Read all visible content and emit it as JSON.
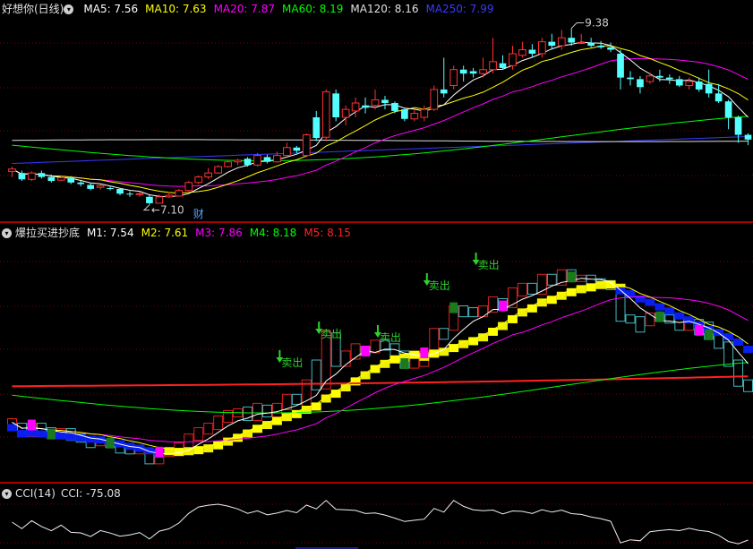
{
  "main": {
    "title": "好想你(日线)",
    "ma": [
      {
        "label": "MA5: 7.56",
        "color": "#ffffff"
      },
      {
        "label": "MA10: 7.63",
        "color": "#ffff00"
      },
      {
        "label": "MA20: 7.87",
        "color": "#ff00ff"
      },
      {
        "label": "MA60: 8.19",
        "color": "#00ff00"
      },
      {
        "label": "MA120: 8.16",
        "color": "#e0e0e0"
      },
      {
        "label": "MA250: 7.99",
        "color": "#3a3aff"
      }
    ],
    "high_label": "9.38",
    "low_label": "7.10",
    "marker_cai": "财"
  },
  "indicator": {
    "title": "爆拉买进抄底",
    "lines": [
      {
        "label": "M1: 7.54",
        "color": "#ffffff"
      },
      {
        "label": "M2: 7.61",
        "color": "#ffff00"
      },
      {
        "label": "M3: 7.86",
        "color": "#ff00ff"
      },
      {
        "label": "M4: 8.18",
        "color": "#00ff00"
      },
      {
        "label": "M5: 8.15",
        "color": "#ff2222"
      }
    ],
    "sell_label": "卖出"
  },
  "cci": {
    "title": "CCI(14)",
    "value": "CCI: -75.08"
  },
  "chart_data": {
    "type": "candlestick",
    "price_range": [
      6.95,
      9.45
    ],
    "candles": [
      [
        7.52,
        7.55,
        7.45,
        7.58
      ],
      [
        7.5,
        7.42,
        7.4,
        7.53
      ],
      [
        7.42,
        7.5,
        7.4,
        7.52
      ],
      [
        7.5,
        7.45,
        7.43,
        7.53
      ],
      [
        7.45,
        7.4,
        7.38,
        7.48
      ],
      [
        7.41,
        7.44,
        7.4,
        7.46
      ],
      [
        7.44,
        7.38,
        7.36,
        7.46
      ],
      [
        7.38,
        7.36,
        7.33,
        7.4
      ],
      [
        7.35,
        7.3,
        7.28,
        7.37
      ],
      [
        7.32,
        7.34,
        7.29,
        7.36
      ],
      [
        7.31,
        7.3,
        7.28,
        7.33
      ],
      [
        7.3,
        7.24,
        7.22,
        7.31
      ],
      [
        7.24,
        7.23,
        7.2,
        7.27
      ],
      [
        7.23,
        7.24,
        7.2,
        7.26
      ],
      [
        7.2,
        7.12,
        7.1,
        7.22
      ],
      [
        7.12,
        7.2,
        7.12,
        7.23
      ],
      [
        7.2,
        7.22,
        7.19,
        7.26
      ],
      [
        7.21,
        7.28,
        7.21,
        7.3
      ],
      [
        7.28,
        7.38,
        7.27,
        7.4
      ],
      [
        7.38,
        7.45,
        7.36,
        7.47
      ],
      [
        7.45,
        7.5,
        7.42,
        7.56
      ],
      [
        7.5,
        7.58,
        7.49,
        7.6
      ],
      [
        7.58,
        7.64,
        7.57,
        7.66
      ],
      [
        7.64,
        7.66,
        7.6,
        7.68
      ],
      [
        7.68,
        7.6,
        7.58,
        7.7
      ],
      [
        7.6,
        7.72,
        7.58,
        7.75
      ],
      [
        7.7,
        7.64,
        7.62,
        7.73
      ],
      [
        7.64,
        7.72,
        7.63,
        7.77
      ],
      [
        7.72,
        7.82,
        7.7,
        7.88
      ],
      [
        7.82,
        7.78,
        7.75,
        7.84
      ],
      [
        7.72,
        7.98,
        7.7,
        8.0
      ],
      [
        8.2,
        7.94,
        7.9,
        8.28
      ],
      [
        7.95,
        8.52,
        7.9,
        8.55
      ],
      [
        8.5,
        8.2,
        8.15,
        8.55
      ],
      [
        8.2,
        8.3,
        8.1,
        8.35
      ],
      [
        8.28,
        8.38,
        8.2,
        8.45
      ],
      [
        8.35,
        8.32,
        8.25,
        8.45
      ],
      [
        8.35,
        8.42,
        8.3,
        8.55
      ],
      [
        8.42,
        8.38,
        8.3,
        8.47
      ],
      [
        8.38,
        8.28,
        8.25,
        8.4
      ],
      [
        8.3,
        8.18,
        8.15,
        8.32
      ],
      [
        8.18,
        8.25,
        8.15,
        8.3
      ],
      [
        8.2,
        8.3,
        8.15,
        8.35
      ],
      [
        8.3,
        8.55,
        8.28,
        8.6
      ],
      [
        8.55,
        8.5,
        8.45,
        8.95
      ],
      [
        8.6,
        8.8,
        8.55,
        8.85
      ],
      [
        8.8,
        8.75,
        8.65,
        8.85
      ],
      [
        8.78,
        8.75,
        8.7,
        8.82
      ],
      [
        8.75,
        8.8,
        8.7,
        8.95
      ],
      [
        8.8,
        8.9,
        8.75,
        9.2
      ],
      [
        8.88,
        8.82,
        8.8,
        8.98
      ],
      [
        8.85,
        9.0,
        8.8,
        9.1
      ],
      [
        8.98,
        9.05,
        8.95,
        9.15
      ],
      [
        9.05,
        9.0,
        8.95,
        9.12
      ],
      [
        9.0,
        9.15,
        8.95,
        9.2
      ],
      [
        9.15,
        9.1,
        9.05,
        9.25
      ],
      [
        9.1,
        9.2,
        9.05,
        9.3
      ],
      [
        9.2,
        9.14,
        9.1,
        9.32
      ],
      [
        9.14,
        9.14,
        9.12,
        9.25
      ],
      [
        9.14,
        9.1,
        9.08,
        9.2
      ],
      [
        9.1,
        9.08,
        9.06,
        9.16
      ],
      [
        9.08,
        9.05,
        9.02,
        9.14
      ],
      [
        9.0,
        8.7,
        8.55,
        9.05
      ],
      [
        8.7,
        8.68,
        8.6,
        8.78
      ],
      [
        8.68,
        8.58,
        8.5,
        8.72
      ],
      [
        8.65,
        8.72,
        8.62,
        8.76
      ],
      [
        8.72,
        8.7,
        8.65,
        8.8
      ],
      [
        8.7,
        8.68,
        8.62,
        8.74
      ],
      [
        8.68,
        8.6,
        8.58,
        8.72
      ],
      [
        8.6,
        8.65,
        8.55,
        8.7
      ],
      [
        8.65,
        8.55,
        8.52,
        8.7
      ],
      [
        8.62,
        8.5,
        8.45,
        8.8
      ],
      [
        8.5,
        8.4,
        8.38,
        8.62
      ],
      [
        8.4,
        8.2,
        8.05,
        8.42
      ],
      [
        8.2,
        7.98,
        7.88,
        8.22
      ],
      [
        7.98,
        7.92,
        7.85,
        8.0
      ]
    ]
  }
}
